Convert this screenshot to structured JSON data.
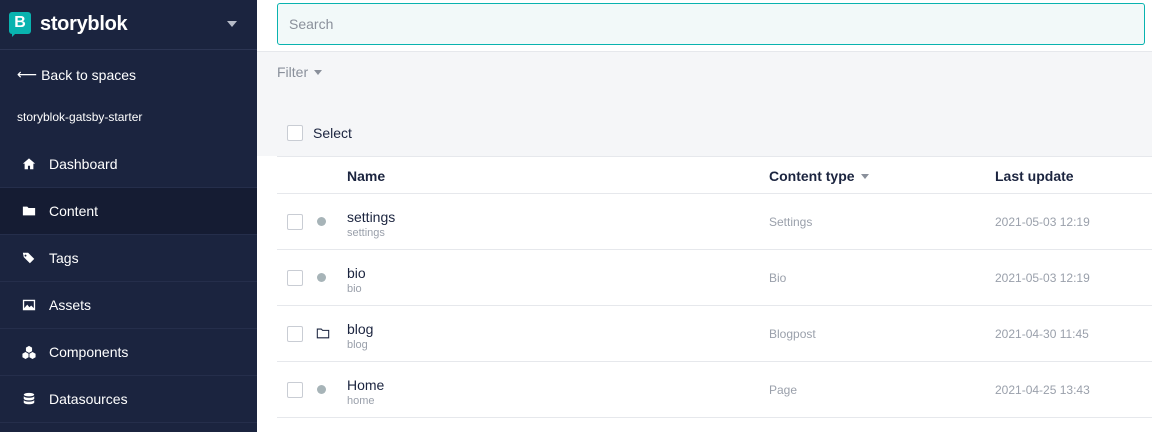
{
  "brand": {
    "name": "storyblok",
    "logo_letter": "B"
  },
  "sidebar": {
    "back_label": "Back to spaces",
    "space_name": "storyblok-gatsby-starter",
    "items": [
      {
        "label": "Dashboard",
        "icon": "home-icon"
      },
      {
        "label": "Content",
        "icon": "folder-icon",
        "active": true
      },
      {
        "label": "Tags",
        "icon": "tags-icon"
      },
      {
        "label": "Assets",
        "icon": "image-icon"
      },
      {
        "label": "Components",
        "icon": "cubes-icon"
      },
      {
        "label": "Datasources",
        "icon": "database-icon"
      }
    ]
  },
  "search": {
    "placeholder": "Search",
    "value": ""
  },
  "filter": {
    "label": "Filter"
  },
  "select": {
    "label": "Select"
  },
  "table": {
    "columns": {
      "name": "Name",
      "content_type": "Content type",
      "last_update": "Last update"
    },
    "rows": [
      {
        "name": "settings",
        "slug": "settings",
        "content_type": "Settings",
        "last_update": "2021-05-03 12:19",
        "kind": "story"
      },
      {
        "name": "bio",
        "slug": "bio",
        "content_type": "Bio",
        "last_update": "2021-05-03 12:19",
        "kind": "story"
      },
      {
        "name": "blog",
        "slug": "blog",
        "content_type": "Blogpost",
        "last_update": "2021-04-30 11:45",
        "kind": "folder"
      },
      {
        "name": "Home",
        "slug": "home",
        "content_type": "Page",
        "last_update": "2021-04-25 13:43",
        "kind": "story"
      }
    ]
  },
  "colors": {
    "sidebar_bg": "#1b243f",
    "accent": "#09b3af",
    "status_dot": "#a7b4b8"
  }
}
